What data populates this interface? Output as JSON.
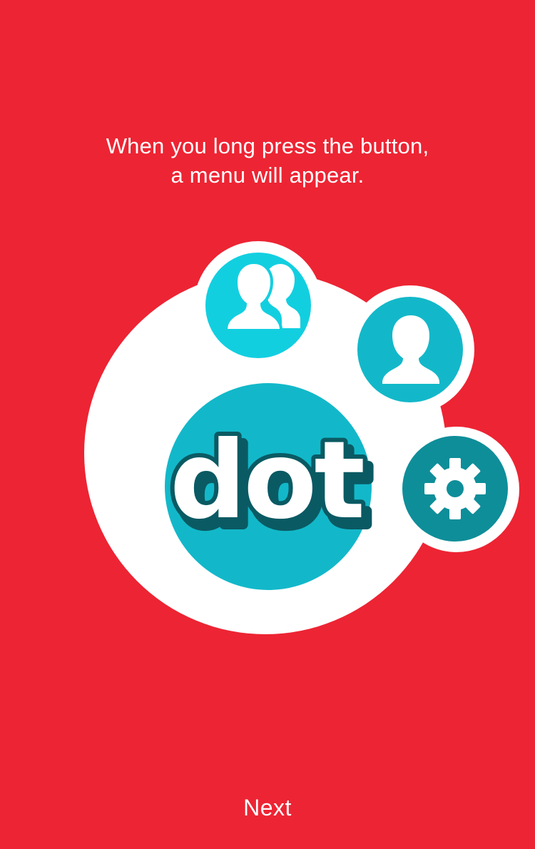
{
  "onboarding": {
    "instruction_line1": "When you long press the button,",
    "instruction_line2": "a menu will appear.",
    "logo_text": "dot",
    "next_label": "Next"
  },
  "menu_items": [
    {
      "icon": "group-icon"
    },
    {
      "icon": "user-icon"
    },
    {
      "icon": "gear-icon"
    }
  ],
  "colors": {
    "background": "#ED2433",
    "panel": "#FFFFFF",
    "teal_light": "#12CFE0",
    "teal": "#12B8C9",
    "teal_dark": "#0E8E99",
    "logo_shadow": "#0A5A63"
  }
}
